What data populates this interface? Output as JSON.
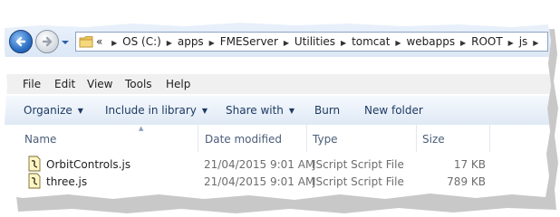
{
  "breadcrumb": {
    "overflow": "«",
    "items": [
      "OS (C:)",
      "apps",
      "FMEServer",
      "Utilities",
      "tomcat",
      "webapps",
      "ROOT",
      "js"
    ]
  },
  "menu": [
    "File",
    "Edit",
    "View",
    "Tools",
    "Help"
  ],
  "commands": {
    "organize": "Organize",
    "include": "Include in library",
    "share": "Share with",
    "burn": "Burn",
    "newfolder": "New folder"
  },
  "columns": {
    "name": "Name",
    "date": "Date modified",
    "type": "Type",
    "size": "Size"
  },
  "files": [
    {
      "name": "OrbitControls.js",
      "date": "21/04/2015 9:01 AM",
      "type": "JScript Script File",
      "size": "17 KB"
    },
    {
      "name": "three.js",
      "date": "21/04/2015 9:01 AM",
      "type": "JScript Script File",
      "size": "789 KB"
    }
  ],
  "icons": {
    "back": "back-arrow-icon",
    "forward": "forward-arrow-icon",
    "recent": "recent-pages-dropdown-icon",
    "folder": "folder-icon",
    "file": "jscript-file-icon"
  }
}
